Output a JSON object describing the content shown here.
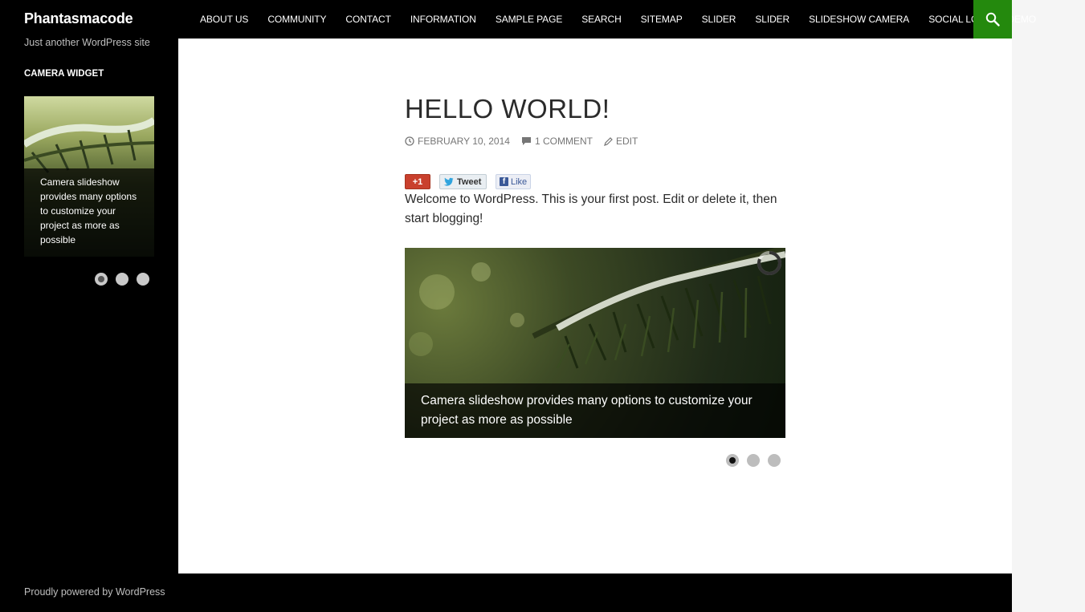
{
  "header": {
    "site_title": "Phantasmacode",
    "tagline": "Just another WordPress site",
    "nav": [
      {
        "label": "ABOUT US"
      },
      {
        "label": "COMMUNITY"
      },
      {
        "label": "CONTACT"
      },
      {
        "label": "INFORMATION"
      },
      {
        "label": "SAMPLE PAGE"
      },
      {
        "label": "SEARCH"
      },
      {
        "label": "SITEMAP"
      },
      {
        "label": "SLIDER"
      },
      {
        "label": "SLIDER"
      },
      {
        "label": "SLIDESHOW CAMERA"
      },
      {
        "label": "SOCIAL LOCKER DEMO"
      }
    ],
    "search_icon": "search-icon",
    "accent_color": "#24890d"
  },
  "sidebar": {
    "widget_title": "CAMERA WIDGET",
    "caption": "Camera slideshow provides many options to customize your project as more as possible",
    "pager_count": 3,
    "active_index": 0
  },
  "post": {
    "title": "HELLO WORLD!",
    "date": "FEBRUARY 10, 2014",
    "comments": "1 COMMENT",
    "edit": "EDIT",
    "share": {
      "gplus": "+1",
      "tweet": "Tweet",
      "like": "Like"
    },
    "body": "Welcome to WordPress. This is your first post. Edit or delete it, then start blogging!",
    "slider_caption": "Camera slideshow provides many options to customize your project as more as possible",
    "pager_count": 3,
    "active_index": 0
  },
  "footer": {
    "credit": "Proudly powered by WordPress"
  }
}
